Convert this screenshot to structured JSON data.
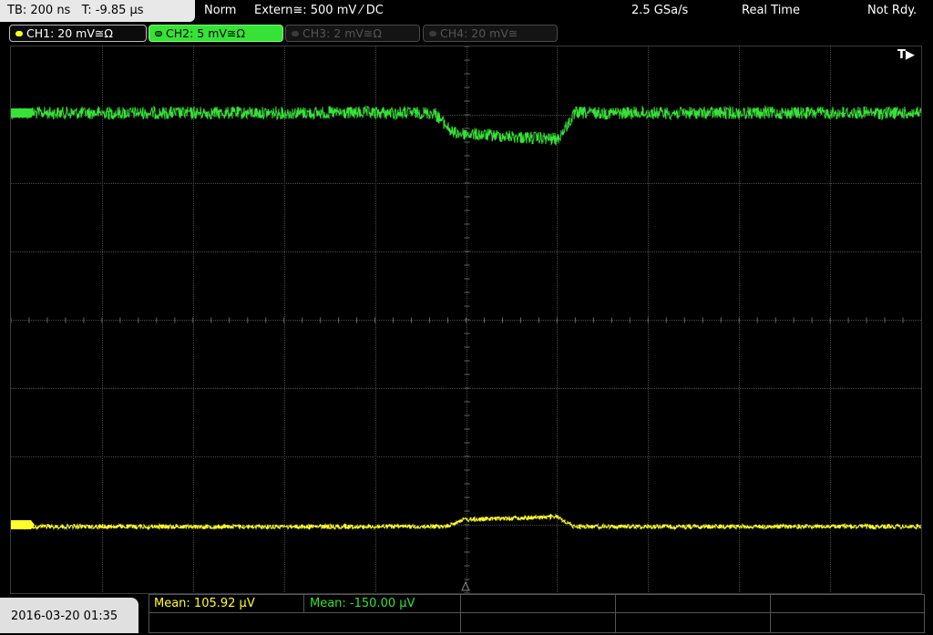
{
  "header": {
    "timebase": "TB: 200 ns   T: -9.85 µs",
    "mode": "Norm",
    "trigger": "Extern≅: 500 mV ⁄ DC",
    "sample_rate": "2.5 GSa/s",
    "acq_mode": "Real Time",
    "status": "Not Rdy."
  },
  "channels": [
    {
      "label": "CH1: 20 mV≅Ω",
      "color": "#ffff2a",
      "active": true
    },
    {
      "label": "CH2: 5 mV≅Ω",
      "color": "#36e236",
      "active": true,
      "selected": true
    },
    {
      "label": "CH3: 2 mV≅Ω",
      "color": "#555555",
      "active": false
    },
    {
      "label": "CH4: 20 mV≅",
      "color": "#555555",
      "active": false
    }
  ],
  "trigger_marker": "T▶",
  "measurements": [
    {
      "text": "Mean: 105.92 µV",
      "color": "#ffff2a"
    },
    {
      "text": "Mean: -150.00 µV",
      "color": "#36e236"
    }
  ],
  "datetime": "2016-03-20 01:35",
  "colors": {
    "grid": "#4a4a4a",
    "ch1": "#ffff2a",
    "ch2": "#36e236"
  },
  "grid": {
    "h_divisions": 10,
    "v_divisions": 8
  }
}
